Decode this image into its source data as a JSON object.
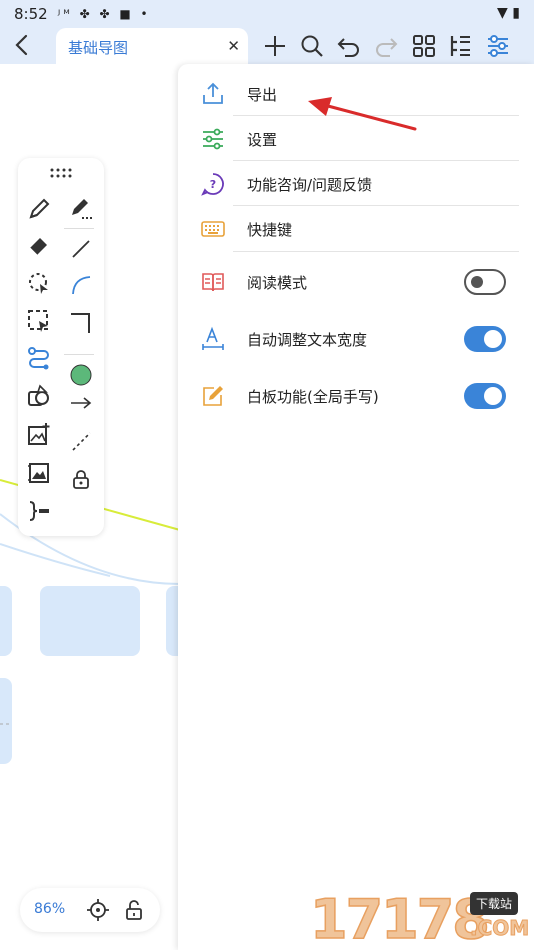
{
  "status_bar": {
    "time": "8:52",
    "icons": [
      "jm-icon",
      "pinwheel-icon",
      "pinwheel-icon",
      "square-icon",
      "dot-icon"
    ],
    "right_icons": [
      "wifi-icon",
      "battery-icon"
    ]
  },
  "top_bar": {
    "tab_title": "基础导图",
    "actions": [
      "add-icon",
      "search-icon",
      "undo-icon",
      "redo-icon",
      "grid-icon",
      "outline-icon",
      "settings-sliders-icon"
    ]
  },
  "toolbar": {
    "tools": [
      "pen-icon",
      "marker-icon",
      "eraser-icon",
      "line-icon",
      "lasso-icon",
      "arc-icon",
      "select-icon",
      "corner-icon",
      "connector-icon",
      "color-swatch",
      "shapes-icon",
      "arrow-icon",
      "image-add-icon",
      "dashed-line-icon",
      "image-frame-icon",
      "lock-icon",
      "bracket-icon"
    ],
    "swatch_color": "#5cb87a"
  },
  "zoom": {
    "percent": "86%"
  },
  "menu": {
    "items": [
      {
        "label": "导出",
        "icon": "export-icon",
        "color": "#4a90d9"
      },
      {
        "label": "设置",
        "icon": "sliders-icon",
        "color": "#3aaa5a"
      },
      {
        "label": "功能咨询/问题反馈",
        "icon": "help-icon",
        "color": "#6a3ab8"
      },
      {
        "label": "快捷键",
        "icon": "keyboard-icon",
        "color": "#e8a23a"
      },
      {
        "label": "阅读模式",
        "icon": "book-icon",
        "color": "#e05a5a",
        "toggle": false
      },
      {
        "label": "自动调整文本宽度",
        "icon": "text-width-icon",
        "color": "#3a84d8",
        "toggle": true
      },
      {
        "label": "白板功能(全局手写)",
        "icon": "whiteboard-icon",
        "color": "#e8a23a",
        "toggle": true
      }
    ]
  },
  "watermark": {
    "text": "17178",
    "badge": "下载站",
    "domain": ".COM"
  }
}
